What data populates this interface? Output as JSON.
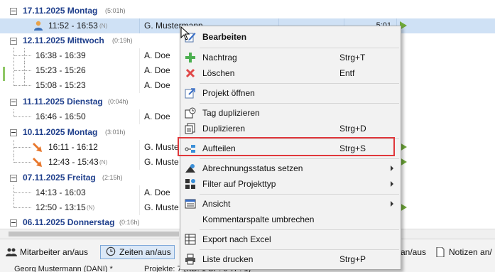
{
  "tree": {
    "rows": [
      {
        "type": "day",
        "date": "17.11.2025 Montag",
        "duration": "(5:01h)"
      },
      {
        "type": "entry",
        "time": "11:52 - 16:53",
        "tag": "(N)",
        "name": "G. Mustermann",
        "sum": "5:01",
        "selected": true,
        "icon": "person-icon"
      },
      {
        "type": "day",
        "date": "12.11.2025 Mittwoch",
        "duration": "(0:19h)"
      },
      {
        "type": "entry",
        "time": "16:38 - 16:39",
        "tag": "",
        "name": "A. Doe"
      },
      {
        "type": "entry",
        "time": "15:23 - 15:26",
        "tag": "",
        "name": "A. Doe"
      },
      {
        "type": "entry",
        "time": "15:08 - 15:23",
        "tag": "",
        "name": "A. Doe"
      },
      {
        "type": "day",
        "date": "11.11.2025 Dienstag",
        "duration": "(0:04h)"
      },
      {
        "type": "entry",
        "time": "16:46 - 16:50",
        "tag": "",
        "name": "A. Doe"
      },
      {
        "type": "day",
        "date": "10.11.2025 Montag",
        "duration": "(3:01h)"
      },
      {
        "type": "entry",
        "time": "16:11 - 16:12",
        "tag": "",
        "name": "G. Muste",
        "icon": "arrow-icon"
      },
      {
        "type": "entry",
        "time": "12:43 - 15:43",
        "tag": "(N)",
        "name": "G. Muste",
        "icon": "arrow-icon"
      },
      {
        "type": "day",
        "date": "07.11.2025 Freitag",
        "duration": "(2:15h)"
      },
      {
        "type": "entry",
        "time": "14:13 - 16:03",
        "tag": "",
        "name": "A. Doe"
      },
      {
        "type": "entry",
        "time": "12:50 - 13:15",
        "tag": "(N)",
        "name": "G. Muste"
      },
      {
        "type": "day",
        "date": "06.11.2025 Donnerstag",
        "duration": "(0:16h)"
      }
    ]
  },
  "toolbar": {
    "mitarbeiter": "Mitarbeiter an/aus",
    "zeiten": "Zeiten an/aus",
    "projekte_partial": "an/aus",
    "notizen": "Notizen an/"
  },
  "status": {
    "user": "Georg Mustermann (DANI) *",
    "projekt": "Projekte: 7 (KD: 1 UP: 6 TP: 1)"
  },
  "menu": {
    "items": [
      {
        "id": "bearbeiten",
        "label": "Bearbeiten",
        "shortcut": "",
        "bold": true,
        "icon": "edit-icon"
      },
      {
        "id": "nachtrag",
        "label": "Nachtrag",
        "shortcut": "Strg+T",
        "icon": "plus-icon"
      },
      {
        "id": "loeschen",
        "label": "Löschen",
        "shortcut": "Entf",
        "icon": "delete-icon"
      },
      {
        "id": "projekt-oeffnen",
        "label": "Projekt öffnen",
        "shortcut": "",
        "icon": "open-project-icon"
      },
      {
        "id": "tag-duplizieren",
        "label": "Tag duplizieren",
        "shortcut": "",
        "icon": "duplicate-day-icon"
      },
      {
        "id": "duplizieren",
        "label": "Duplizieren",
        "shortcut": "Strg+D",
        "icon": "duplicate-icon"
      },
      {
        "id": "aufteilen",
        "label": "Aufteilen",
        "shortcut": "Strg+S",
        "icon": "split-icon"
      },
      {
        "id": "abrechnungsstatus",
        "label": "Abrechnungsstatus setzen",
        "shortcut": "",
        "submenu": true,
        "icon": "billing-icon"
      },
      {
        "id": "filter",
        "label": "Filter auf Projekttyp",
        "shortcut": "",
        "submenu": true,
        "icon": "filter-icon"
      },
      {
        "id": "ansicht",
        "label": "Ansicht",
        "shortcut": "",
        "submenu": true,
        "icon": "view-icon"
      },
      {
        "id": "kommentarspalte",
        "label": "Kommentarspalte umbrechen",
        "shortcut": ""
      },
      {
        "id": "export",
        "label": "Export nach Excel",
        "shortcut": "",
        "icon": "excel-icon"
      },
      {
        "id": "drucken",
        "label": "Liste drucken",
        "shortcut": "Strg+P",
        "icon": "print-icon"
      }
    ]
  },
  "colors": {
    "date": "#1f3f8c",
    "selected_row": "#cfe1f5",
    "highlight": "#e0373b",
    "menu_bg": "#f2f2f2"
  }
}
